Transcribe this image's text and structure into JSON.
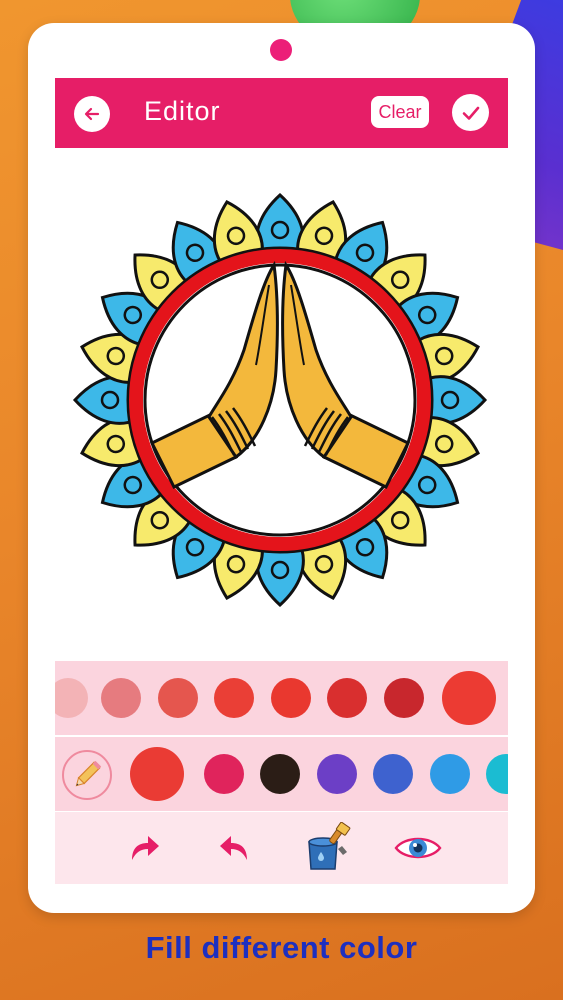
{
  "header": {
    "title": "Editor",
    "clear_label": "Clear"
  },
  "palette": {
    "row1": [
      "#f3b3b6",
      "#e67b7f",
      "#e5564e",
      "#ea3f36",
      "#e9382f",
      "#d92f2f",
      "#c8272d",
      "#ec3b33"
    ],
    "row2": [
      "#ea3b34",
      "#e0245c",
      "#2b1d16",
      "#6c3fc6",
      "#3e62cf",
      "#2f9be6",
      "#1bbcd2"
    ]
  },
  "tools": [
    "redo-icon",
    "undo-icon",
    "paint-bucket-icon",
    "preview-eye-icon"
  ],
  "caption": "Fill different color",
  "colors": {
    "accent": "#e61e67",
    "caption": "#1d2fbf"
  }
}
